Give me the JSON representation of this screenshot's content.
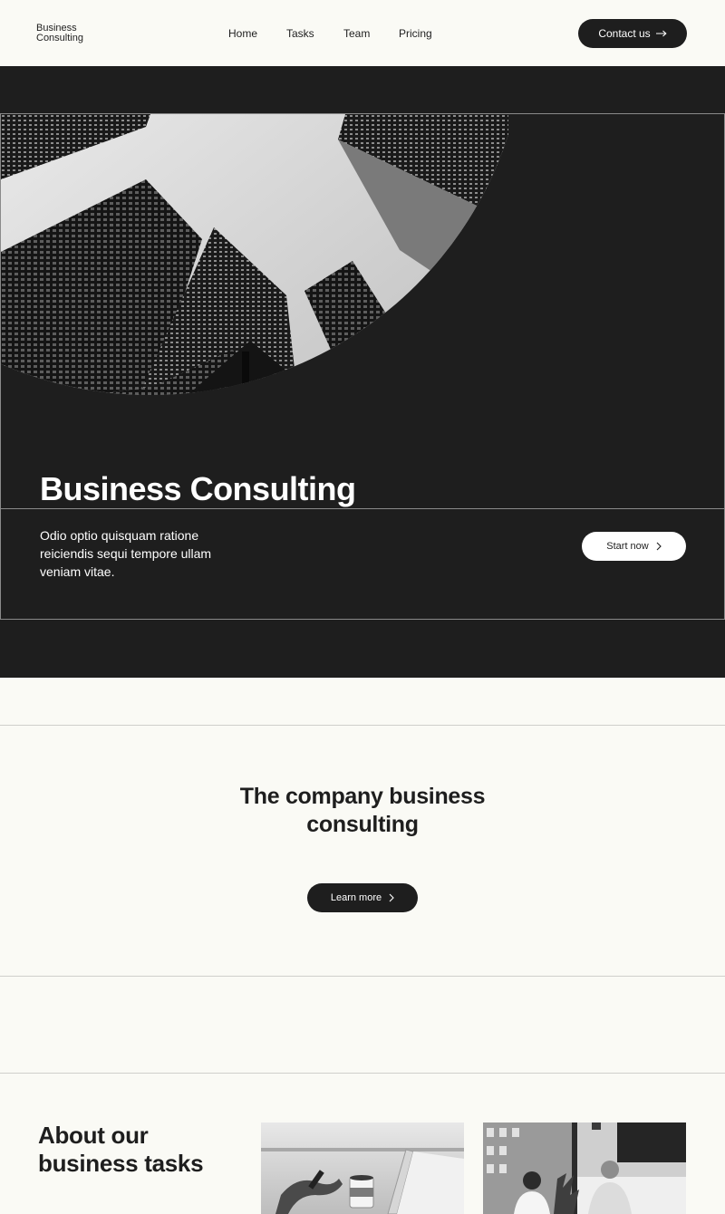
{
  "header": {
    "logo_line1": "Business",
    "logo_line2": "Consulting",
    "nav": [
      "Home",
      "Tasks",
      "Team",
      "Pricing"
    ],
    "contact_label": "Contact us",
    "contact_icon": "arrow-right-icon"
  },
  "hero": {
    "title": "Business Consulting",
    "description": "Odio optio quisquam ratione reiciendis sequi tempore ullam veniam vitae.",
    "start_label": "Start now",
    "start_icon": "chevron-right-icon"
  },
  "company": {
    "title_line1": "The company business",
    "title_line2": "consulting",
    "learn_label": "Learn more",
    "learn_icon": "chevron-right-icon"
  },
  "about": {
    "title_line1": "About our",
    "title_line2": "business tasks"
  },
  "colors": {
    "background": "#fafaf5",
    "dark": "#1e1e1e",
    "border": "#8a8a8a",
    "white": "#ffffff"
  }
}
